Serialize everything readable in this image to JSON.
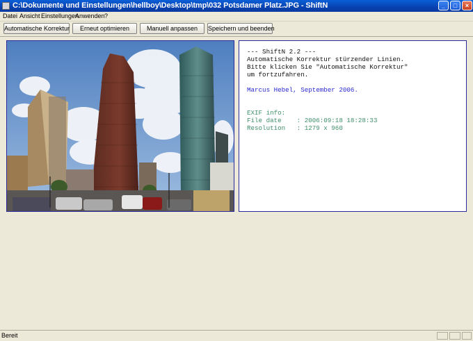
{
  "window": {
    "title": "C:\\Dokumente und Einstellungen\\hellboy\\Desktop\\tmp\\032  Potsdamer Platz.JPG - ShiftN",
    "minimize_glyph": "_",
    "maximize_glyph": "□",
    "close_glyph": "×"
  },
  "menu": {
    "items": [
      "Datei",
      "Ansicht",
      "Einstellungen",
      "Anwenden",
      "?"
    ]
  },
  "toolbar": {
    "buttons": [
      "Automatische Korrektur",
      "Erneut optimieren",
      "Manuell anpassen",
      "Speichern und beenden"
    ]
  },
  "info": {
    "lines": [
      {
        "text": "--- ShiftN 2.2 ---",
        "color": "#111111"
      },
      {
        "text": "Automatische Korrektur stürzender Linien.",
        "color": "#111111"
      },
      {
        "text": "Bitte klicken Sie \"Automatische Korrektur\"",
        "color": "#111111"
      },
      {
        "text": "um fortzufahren.",
        "color": "#111111"
      },
      {
        "text": "",
        "color": "#111111"
      },
      {
        "text": "Marcus Hebel, September 2006.",
        "color": "#2a2ad0"
      },
      {
        "text": "",
        "color": "#111111"
      },
      {
        "text": "",
        "color": "#111111"
      },
      {
        "text": "EXIF info:",
        "color": "#3f8f6b"
      },
      {
        "text": "File date    : 2006:09:18 18:28:33",
        "color": "#3f8f6b"
      },
      {
        "text": "Resolution   : 1279 x 960",
        "color": "#3f8f6b"
      }
    ]
  },
  "status": {
    "text": "Bereit"
  },
  "colors": {
    "titlebar": "#0842b0",
    "panel_border": "#2a2a9c",
    "info_blue": "#2a2ad0",
    "info_green": "#3f8f6b"
  }
}
